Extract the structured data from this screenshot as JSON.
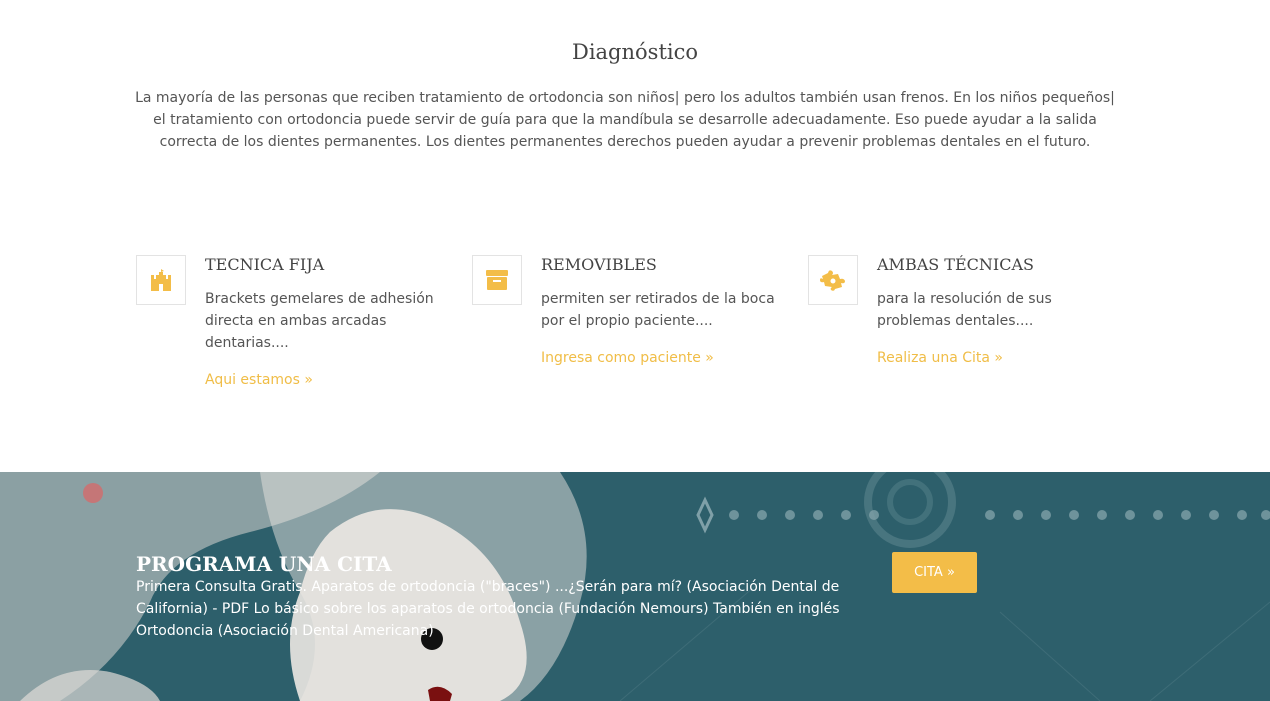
{
  "diagnostico": {
    "title": "Diagnóstico",
    "text": "La mayoría de las personas que reciben tratamiento de ortodoncia son niños| pero los adultos también usan frenos. En los niños pequeños| el tratamiento con ortodoncia puede servir de guía para que la mandíbula se desarrolle adecuadamente. Eso puede ayudar a la salida correcta de los dientes permanentes. Los dientes permanentes derechos pueden ayudar a prevenir problemas dentales en el futuro."
  },
  "features": [
    {
      "icon": "castle-icon",
      "title": "TECNICA FIJA",
      "text": "Brackets gemelares de adhesión directa en ambas arcadas dentarias....",
      "link": "Aqui estamos »"
    },
    {
      "icon": "archive-box-icon",
      "title": "REMOVIBLES",
      "text": "permiten ser retirados de la boca por el propio paciente....",
      "link": "Ingresa como paciente »"
    },
    {
      "icon": "puzzle-piece-icon",
      "title": "AMBAS TÉCNICAS",
      "text": "para la resolución de sus problemas dentales....",
      "link": "Realiza una Cita »"
    }
  ],
  "cita": {
    "title": "PROGRAMA UNA CITA",
    "text": "Primera Consulta Gratis. Aparatos de ortodoncia (\"braces\") ...¿Serán para mí? (Asociación Dental de California) - PDF Lo básico sobre los aparatos de ortodoncia (Fundación Nemours) También en inglés Ortodoncia (Asociación Dental Americana)",
    "button": "CITA »"
  },
  "colors": {
    "accent": "#f3bd48",
    "band_bg": "#2d5f6b",
    "heading": "#444444",
    "text": "#555555"
  }
}
